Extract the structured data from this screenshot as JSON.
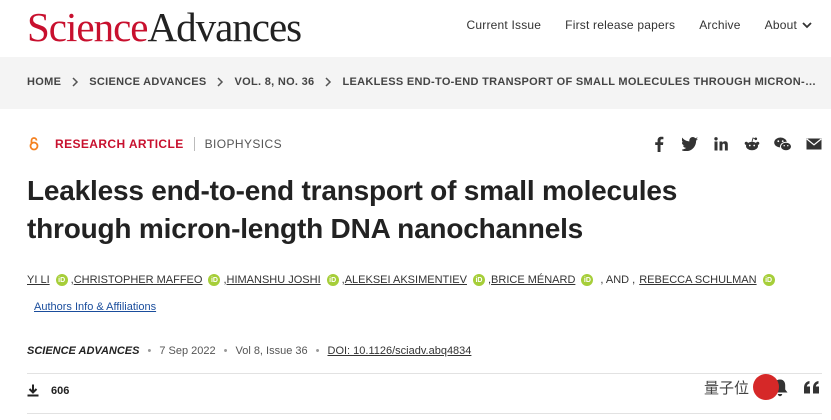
{
  "header": {
    "logo_part1": "Science",
    "logo_part2": "Advances",
    "nav": [
      "Current Issue",
      "First release papers",
      "Archive"
    ],
    "about_label": "About"
  },
  "breadcrumb": [
    "HOME",
    "SCIENCE ADVANCES",
    "VOL. 8, NO. 36",
    "LEAKLESS END-TO-END TRANSPORT OF SMALL MOLECULES THROUGH MICRON-…"
  ],
  "article": {
    "type": "RESEARCH ARTICLE",
    "subject": "BIOPHYSICS",
    "title": "Leakless end-to-end transport of small molecules through micron-length DNA nanochannels",
    "authors": [
      "YI LI",
      "CHRISTOPHER MAFFEO",
      "HIMANSHU JOSHI",
      "ALEKSEI AKSIMENTIEV",
      "BRICE MÉNARD",
      "REBECCA SCHULMAN"
    ],
    "authors_and": ", AND ,",
    "affiliations_link": "Authors Info & Affiliations",
    "journal": "SCIENCE ADVANCES",
    "date": "7 Sep 2022",
    "volume": "Vol 8, Issue 36",
    "doi": "DOI: 10.1126/sciadv.abq4834",
    "downloads": "606"
  },
  "watermark": "量子位",
  "icons": [
    "open-access-icon",
    "facebook-icon",
    "twitter-icon",
    "linkedin-icon",
    "reddit-icon",
    "wechat-icon",
    "email-icon",
    "download-icon",
    "bell-icon",
    "quote-icon"
  ],
  "colors": {
    "accent": "#c8102e",
    "orcid": "#a6ce39",
    "link": "#1a4d9c"
  }
}
